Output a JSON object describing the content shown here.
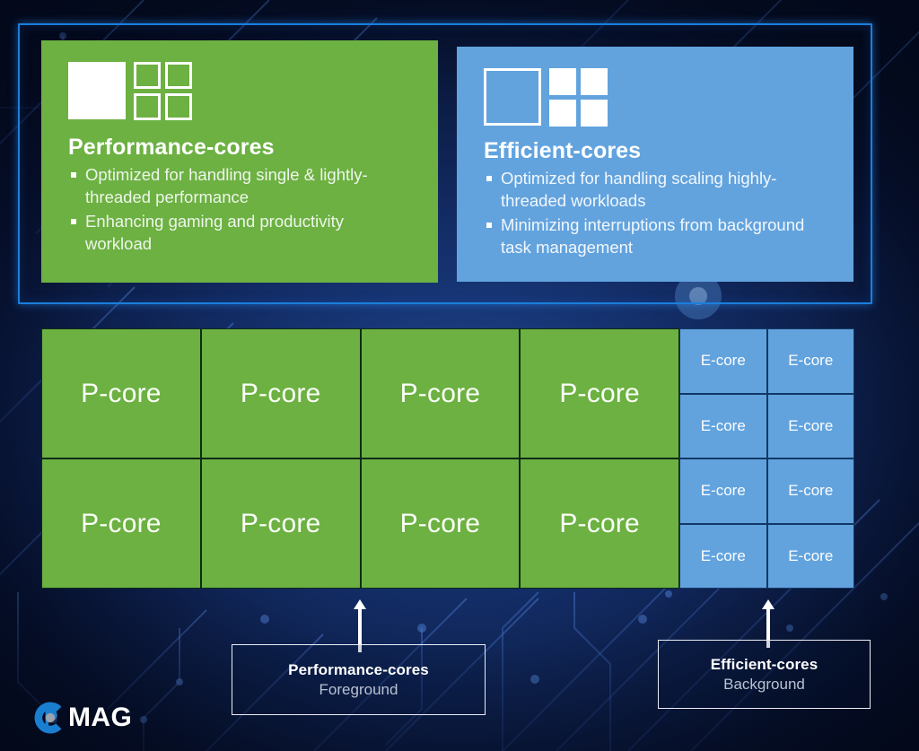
{
  "frame": {
    "cards": [
      {
        "id": "performance-cores",
        "title": "Performance-cores",
        "color": "#6cb142",
        "icon": "big-filled-square-with-four-outlined-squares-icon",
        "bullets": [
          "Optimized for handling single & lightly-threaded performance",
          "Enhancing gaming and productivity workload"
        ]
      },
      {
        "id": "efficient-cores",
        "title": "Efficient-cores",
        "color": "#62a3de",
        "icon": "big-outlined-square-with-four-filled-squares-icon",
        "bullets": [
          "Optimized for handling scaling highly-threaded workloads",
          "Minimizing interruptions from background task management"
        ]
      }
    ]
  },
  "core_grid": {
    "p_cores": {
      "label": "P-core",
      "columns": 4,
      "rows": 2,
      "count": 8,
      "color": "#6cb142",
      "cells": [
        "P-core",
        "P-core",
        "P-core",
        "P-core",
        "P-core",
        "P-core",
        "P-core",
        "P-core"
      ]
    },
    "e_cores": {
      "label": "E-core",
      "columns": 2,
      "rows": 4,
      "count": 8,
      "color": "#62a3de",
      "cells": [
        "E-core",
        "E-core",
        "E-core",
        "E-core",
        "E-core",
        "E-core",
        "E-core",
        "E-core"
      ]
    }
  },
  "callouts": [
    {
      "id": "performance-cores-callout",
      "title": "Performance-cores",
      "subtitle": "Foreground"
    },
    {
      "id": "efficient-cores-callout",
      "title": "Efficient-cores",
      "subtitle": "Background"
    }
  ],
  "logo": {
    "mark": "c-circle-logo-icon",
    "wordmark": "MAG",
    "mark_color": "#1a7ed0",
    "dot_color": "#9aa3ad"
  },
  "colors": {
    "frame_border": "#1a7fdc",
    "background_deep": "#061330",
    "background_mid": "#15326e",
    "green": "#6cb142",
    "blue": "#62a3de",
    "white": "#ffffff",
    "callout_subtitle": "#b9c2d2"
  }
}
